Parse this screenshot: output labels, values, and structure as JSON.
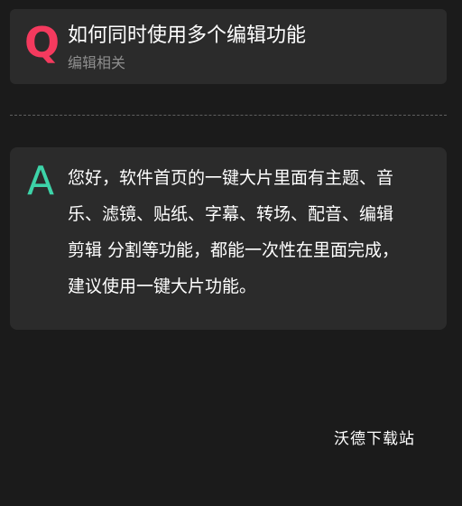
{
  "question": {
    "marker": "Q",
    "title": "如何同时使用多个编辑功能",
    "category": "编辑相关"
  },
  "answer": {
    "marker": "A",
    "lines": [
      "您好，软件首页的一键大片里面有主题、音",
      "乐、滤镜、贴纸、字幕、转场、配音、编辑",
      "剪辑 分割等功能，都能一次性在里面完成，",
      "建议使用一键大片功能。"
    ]
  },
  "watermark": "沃德下载站",
  "colors": {
    "background": "#1b1b1b",
    "card": "#2b2b2b",
    "q_accent": "#f43a5e",
    "a_accent": "#3dd3a8",
    "subtle_text": "#8e8e8e"
  }
}
